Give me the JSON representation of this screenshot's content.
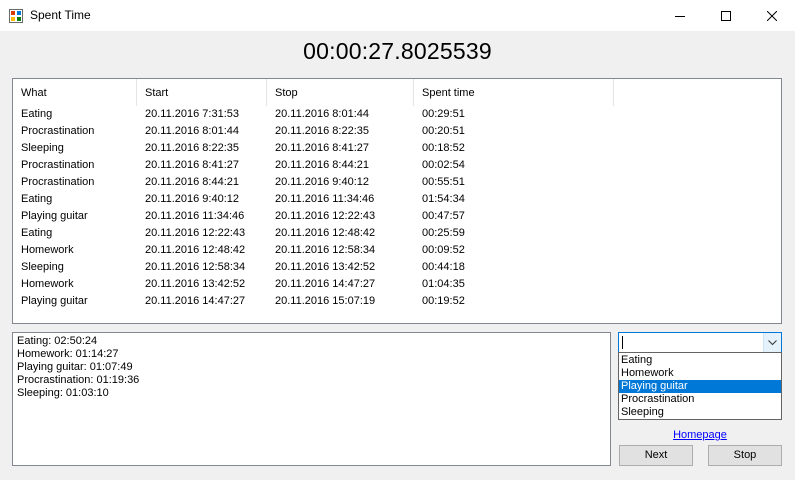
{
  "window": {
    "title": "Spent Time"
  },
  "timer": "00:00:27.8025539",
  "table": {
    "columns": [
      "What",
      "Start",
      "Stop",
      "Spent time"
    ],
    "rows": [
      [
        "Eating",
        "20.11.2016 7:31:53",
        "20.11.2016 8:01:44",
        "00:29:51"
      ],
      [
        "Procrastination",
        "20.11.2016 8:01:44",
        "20.11.2016 8:22:35",
        "00:20:51"
      ],
      [
        "Sleeping",
        "20.11.2016 8:22:35",
        "20.11.2016 8:41:27",
        "00:18:52"
      ],
      [
        "Procrastination",
        "20.11.2016 8:41:27",
        "20.11.2016 8:44:21",
        "00:02:54"
      ],
      [
        "Procrastination",
        "20.11.2016 8:44:21",
        "20.11.2016 9:40:12",
        "00:55:51"
      ],
      [
        "Eating",
        "20.11.2016 9:40:12",
        "20.11.2016 11:34:46",
        "01:54:34"
      ],
      [
        "Playing guitar",
        "20.11.2016 11:34:46",
        "20.11.2016 12:22:43",
        "00:47:57"
      ],
      [
        "Eating",
        "20.11.2016 12:22:43",
        "20.11.2016 12:48:42",
        "00:25:59"
      ],
      [
        "Homework",
        "20.11.2016 12:48:42",
        "20.11.2016 12:58:34",
        "00:09:52"
      ],
      [
        "Sleeping",
        "20.11.2016 12:58:34",
        "20.11.2016 13:42:52",
        "00:44:18"
      ],
      [
        "Homework",
        "20.11.2016 13:42:52",
        "20.11.2016 14:47:27",
        "01:04:35"
      ],
      [
        "Playing guitar",
        "20.11.2016 14:47:27",
        "20.11.2016 15:07:19",
        "00:19:52"
      ]
    ]
  },
  "summary": [
    "Eating: 02:50:24",
    "Homework: 01:14:27",
    "Playing guitar: 01:07:49",
    "Procrastination: 01:19:36",
    "Sleeping: 01:03:10"
  ],
  "combo": {
    "value": "",
    "options": [
      "Eating",
      "Homework",
      "Playing guitar",
      "Procrastination",
      "Sleeping"
    ],
    "highlighted": "Playing guitar"
  },
  "links": {
    "homepage": "Homepage"
  },
  "buttons": {
    "next": "Next",
    "stop": "Stop"
  },
  "colors": {
    "selection": "#0078d7",
    "link": "#0000ff",
    "combo_border": "#0078d7"
  }
}
